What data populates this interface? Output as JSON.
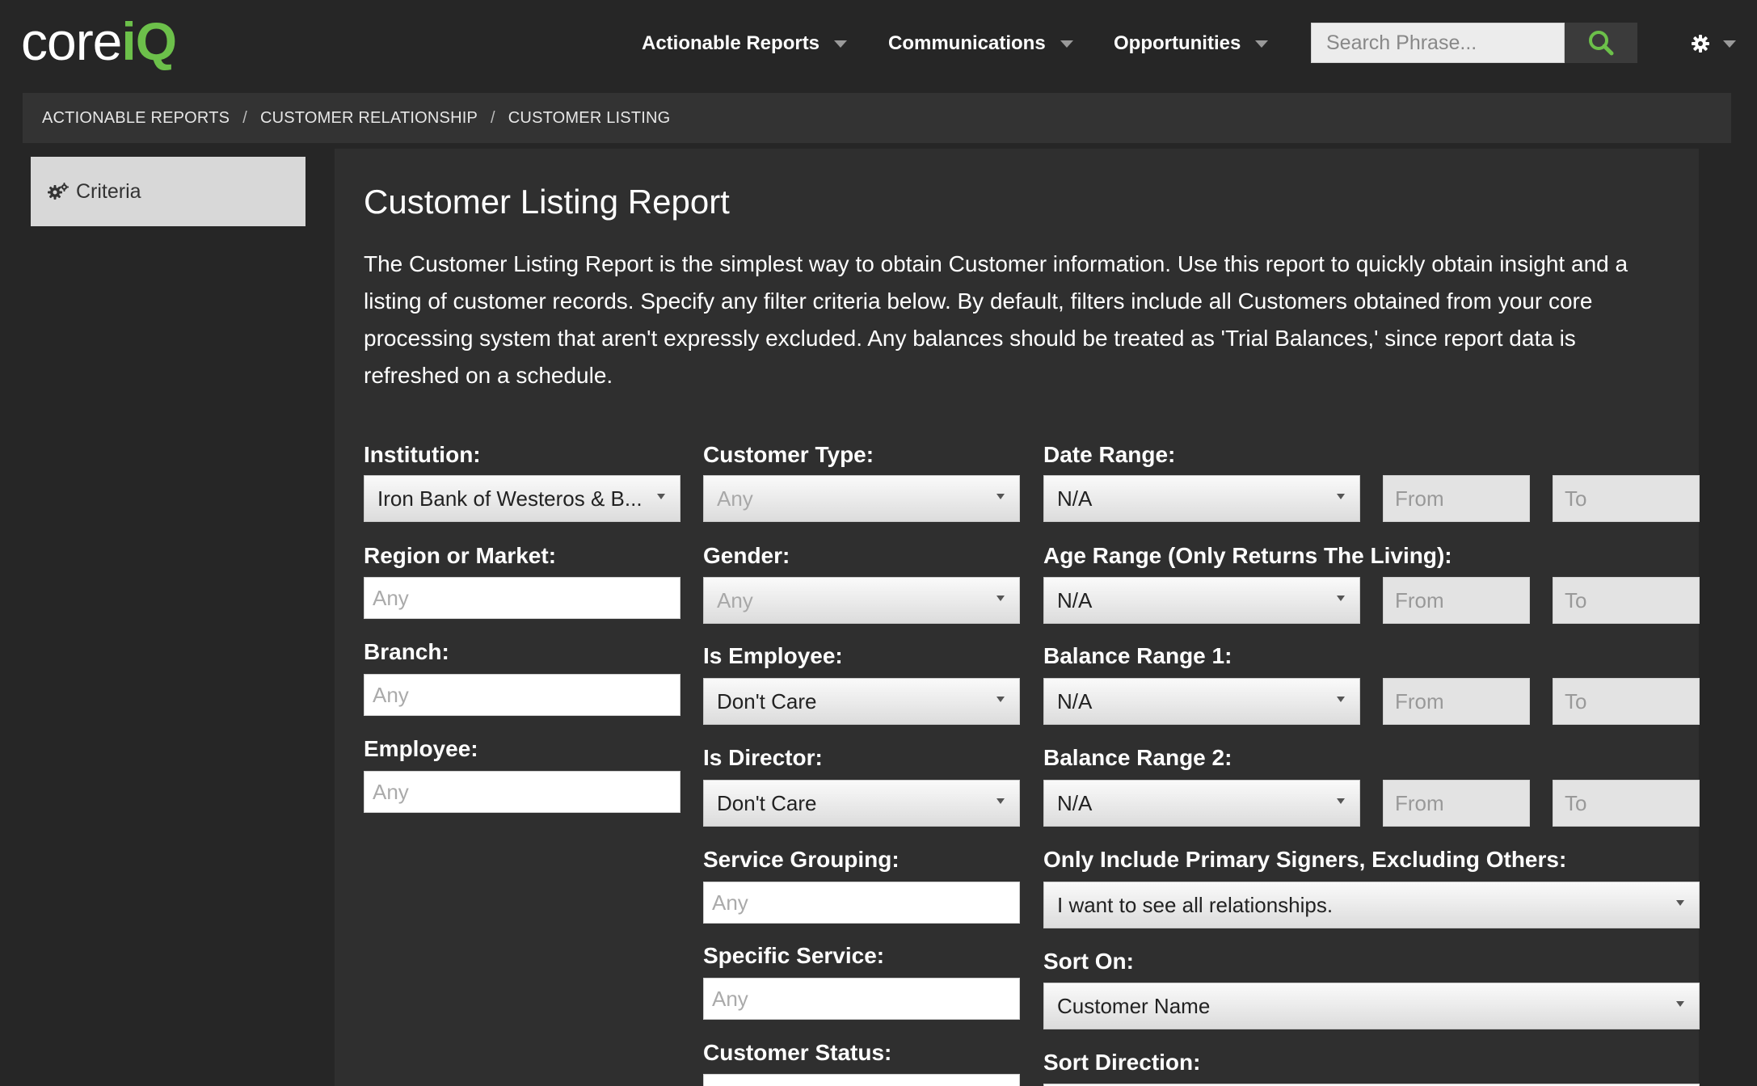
{
  "brand": {
    "logo_core": "core",
    "logo_iq": "iQ"
  },
  "nav": [
    {
      "label": "Actionable Reports"
    },
    {
      "label": "Communications"
    },
    {
      "label": "Opportunities"
    }
  ],
  "search": {
    "placeholder": "Search Phrase..."
  },
  "breadcrumb": [
    "ACTIONABLE REPORTS",
    "CUSTOMER RELATIONSHIP",
    "CUSTOMER LISTING"
  ],
  "sidebar": {
    "criteria_label": "Criteria"
  },
  "page": {
    "title": "Customer Listing Report",
    "description": "The Customer Listing Report is the simplest way to obtain Customer information. Use this report to quickly obtain insight and a listing of customer records. Specify any filter criteria below. By default, filters include all Customers obtained from your core processing system that aren't expressly excluded. Any balances should be treated as 'Trial Balances,' since report data is refreshed on a schedule."
  },
  "form": {
    "institution": {
      "label": "Institution:",
      "value": "Iron Bank of Westeros & B..."
    },
    "region": {
      "label": "Region or Market:",
      "placeholder": "Any"
    },
    "branch": {
      "label": "Branch:",
      "placeholder": "Any"
    },
    "employee": {
      "label": "Employee:",
      "placeholder": "Any"
    },
    "customer_type": {
      "label": "Customer Type:",
      "value": "Any"
    },
    "gender": {
      "label": "Gender:",
      "value": "Any"
    },
    "is_employee": {
      "label": "Is Employee:",
      "value": "Don't Care"
    },
    "is_director": {
      "label": "Is Director:",
      "value": "Don't Care"
    },
    "service_grouping": {
      "label": "Service Grouping:",
      "placeholder": "Any"
    },
    "specific_service": {
      "label": "Specific Service:",
      "placeholder": "Any"
    },
    "customer_status": {
      "label": "Customer Status:"
    },
    "date_range": {
      "label": "Date Range:",
      "value": "N/A",
      "from": "From",
      "to": "To"
    },
    "age_range": {
      "label": "Age Range (Only Returns The Living):",
      "value": "N/A",
      "from": "From",
      "to": "To"
    },
    "balance_range_1": {
      "label": "Balance Range 1:",
      "value": "N/A",
      "from": "From",
      "to": "To"
    },
    "balance_range_2": {
      "label": "Balance Range 2:",
      "value": "N/A",
      "from": "From",
      "to": "To"
    },
    "primary_signers": {
      "label": "Only Include Primary Signers, Excluding Others:",
      "value": "I want to see all relationships."
    },
    "sort_on": {
      "label": "Sort On:",
      "value": "Customer Name"
    },
    "sort_direction": {
      "label": "Sort Direction:"
    }
  },
  "colors": {
    "accent": "#6cc04a",
    "background": "#262626",
    "panel": "#2f2f2f"
  }
}
